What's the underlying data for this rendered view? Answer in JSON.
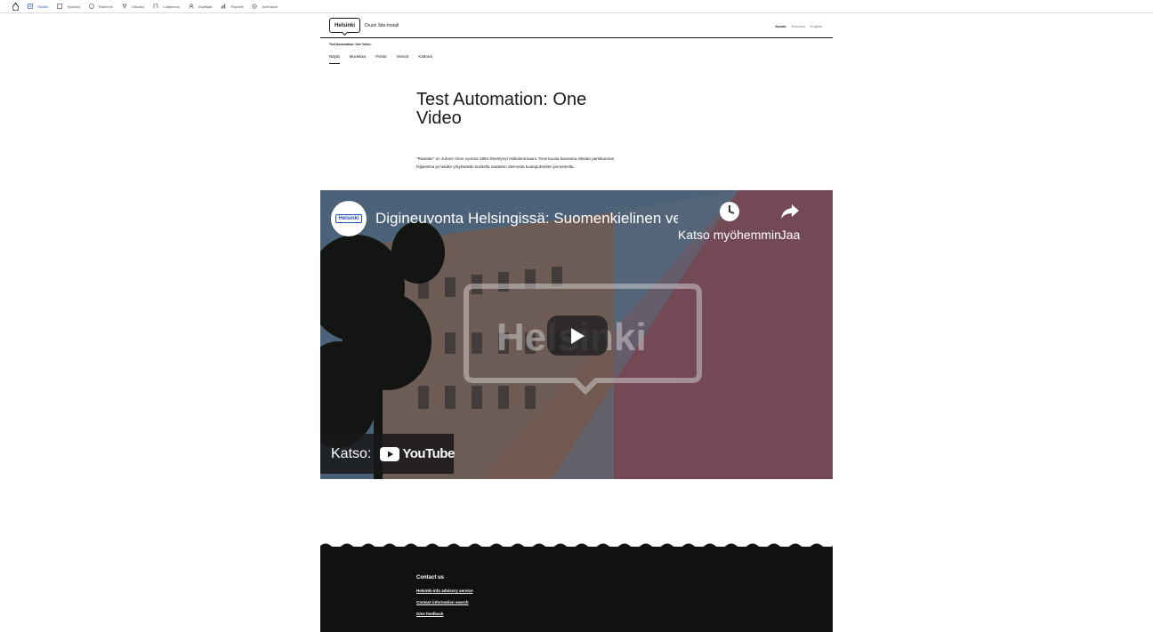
{
  "toolbar": {
    "items": [
      {
        "label": "Sisältö",
        "icon": "content-icon"
      },
      {
        "label": "Työkalut",
        "icon": "tools-icon"
      },
      {
        "label": "Rakenne",
        "icon": "structure-icon"
      },
      {
        "label": "Ulkoasu",
        "icon": "appearance-icon"
      },
      {
        "label": "Laajennus",
        "icon": "extend-icon"
      },
      {
        "label": "Käyttäjät",
        "icon": "people-icon"
      },
      {
        "label": "Raportit",
        "icon": "reports-icon"
      },
      {
        "label": "Asetukset",
        "icon": "config-icon"
      }
    ]
  },
  "header": {
    "logo_text": "Helsinki",
    "site_name": "Drush Site-Install",
    "languages": [
      "Suomi",
      "Svenska",
      "English"
    ]
  },
  "breadcrumb": "Test Automation: One Video",
  "tabs": [
    "Näytä",
    "Muokkaa",
    "Poista",
    "Versiot",
    "Käännä"
  ],
  "page": {
    "title": "Test Automation: One Video",
    "lead": "\"Rautatie\" on Juhani Ahon vuonna 1884 ilmestynyt esikoisromaani. Teos kuvaa karvessa eläviän pariskunnan hiljaiseloa ja heidän yritykseään kuvitella rautatien olemusta kuulopuheiden perusteella."
  },
  "video": {
    "channel_logo_text": "Helsinki",
    "title": "Digineuvonta Helsingissä: Suomenkielinen versio",
    "watch_later_label": "Katso myöhemmin",
    "share_label": "Jaa",
    "watch_on_label": "Katso:",
    "youtube_label": "YouTube",
    "watermark_text": "Helsinki",
    "colors": {
      "blue": "#5d7894",
      "pink": "#8e5a69"
    }
  },
  "footer": {
    "heading": "Contact us",
    "links": [
      "Helsinki-info advisory service",
      "Contact information search",
      "Give feedback"
    ]
  }
}
